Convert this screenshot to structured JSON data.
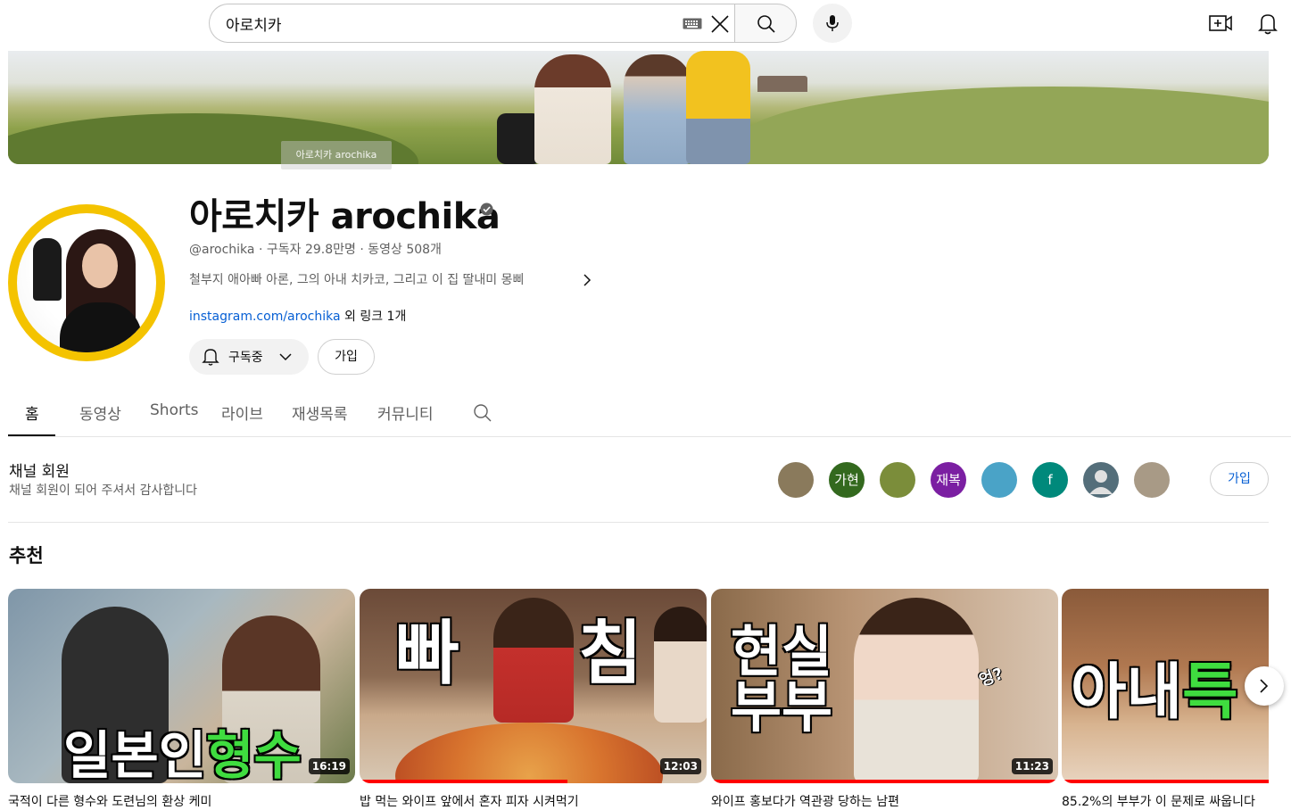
{
  "search": {
    "value": "아로치카"
  },
  "channel": {
    "banner_text": "아로치카 arochika",
    "name": "아로치카 arochika",
    "handle": "@arochika",
    "subscribers": "구독자 29.8만명",
    "videos": "동영상 508개",
    "description": "철부지 애아빠 아론, 그의 아내 치카코, 그리고 이 집 딸내미 몽삐",
    "link": "instagram.com/arochika",
    "link_more": "외 링크 1개",
    "subscribe_label": "구독중",
    "join_label": "가입"
  },
  "tabs": [
    "홈",
    "동영상",
    "Shorts",
    "라이브",
    "재생목록",
    "커뮤니티"
  ],
  "membership": {
    "title": "채널 회원",
    "subtitle": "채널 회원이 되어 주셔서 감사합니다",
    "join_label": "가입",
    "members": [
      {
        "initials": "",
        "color": "#8a7a5c"
      },
      {
        "initials": "가현",
        "color": "#33691e"
      },
      {
        "initials": "",
        "color": "#7b8d3a"
      },
      {
        "initials": "재복",
        "color": "#7b1fa2"
      },
      {
        "initials": "",
        "color": "#4aa3c7"
      },
      {
        "initials": "f",
        "color": "#00897b"
      },
      {
        "initials": "",
        "color": "#546e7a"
      },
      {
        "initials": "",
        "color": "#a89a86"
      }
    ]
  },
  "section_title": "추천",
  "videos": [
    {
      "thumb_text_a": "일본인",
      "thumb_text_b": "형수",
      "duration": "16:19",
      "title": "국적이 다른 형수와 도련님의 환상 케미",
      "progress": 0
    },
    {
      "thumb_text_a": "빠",
      "thumb_text_b": "침",
      "duration": "12:03",
      "title": "밥 먹는 와이프 앞에서 혼자 피자 시켜먹기",
      "progress": 60
    },
    {
      "thumb_text_a": "현실",
      "thumb_text_b": "부부",
      "thumb_text_c": "엉?",
      "duration": "11:23",
      "title": "와이프 홍보다가 역관광 당하는 남편",
      "progress": 100
    },
    {
      "thumb_text_a": "아내",
      "thumb_text_b": "특",
      "duration": "",
      "title": "85.2%의 부부가 이 문제로 싸웁니다",
      "progress": 100
    }
  ]
}
